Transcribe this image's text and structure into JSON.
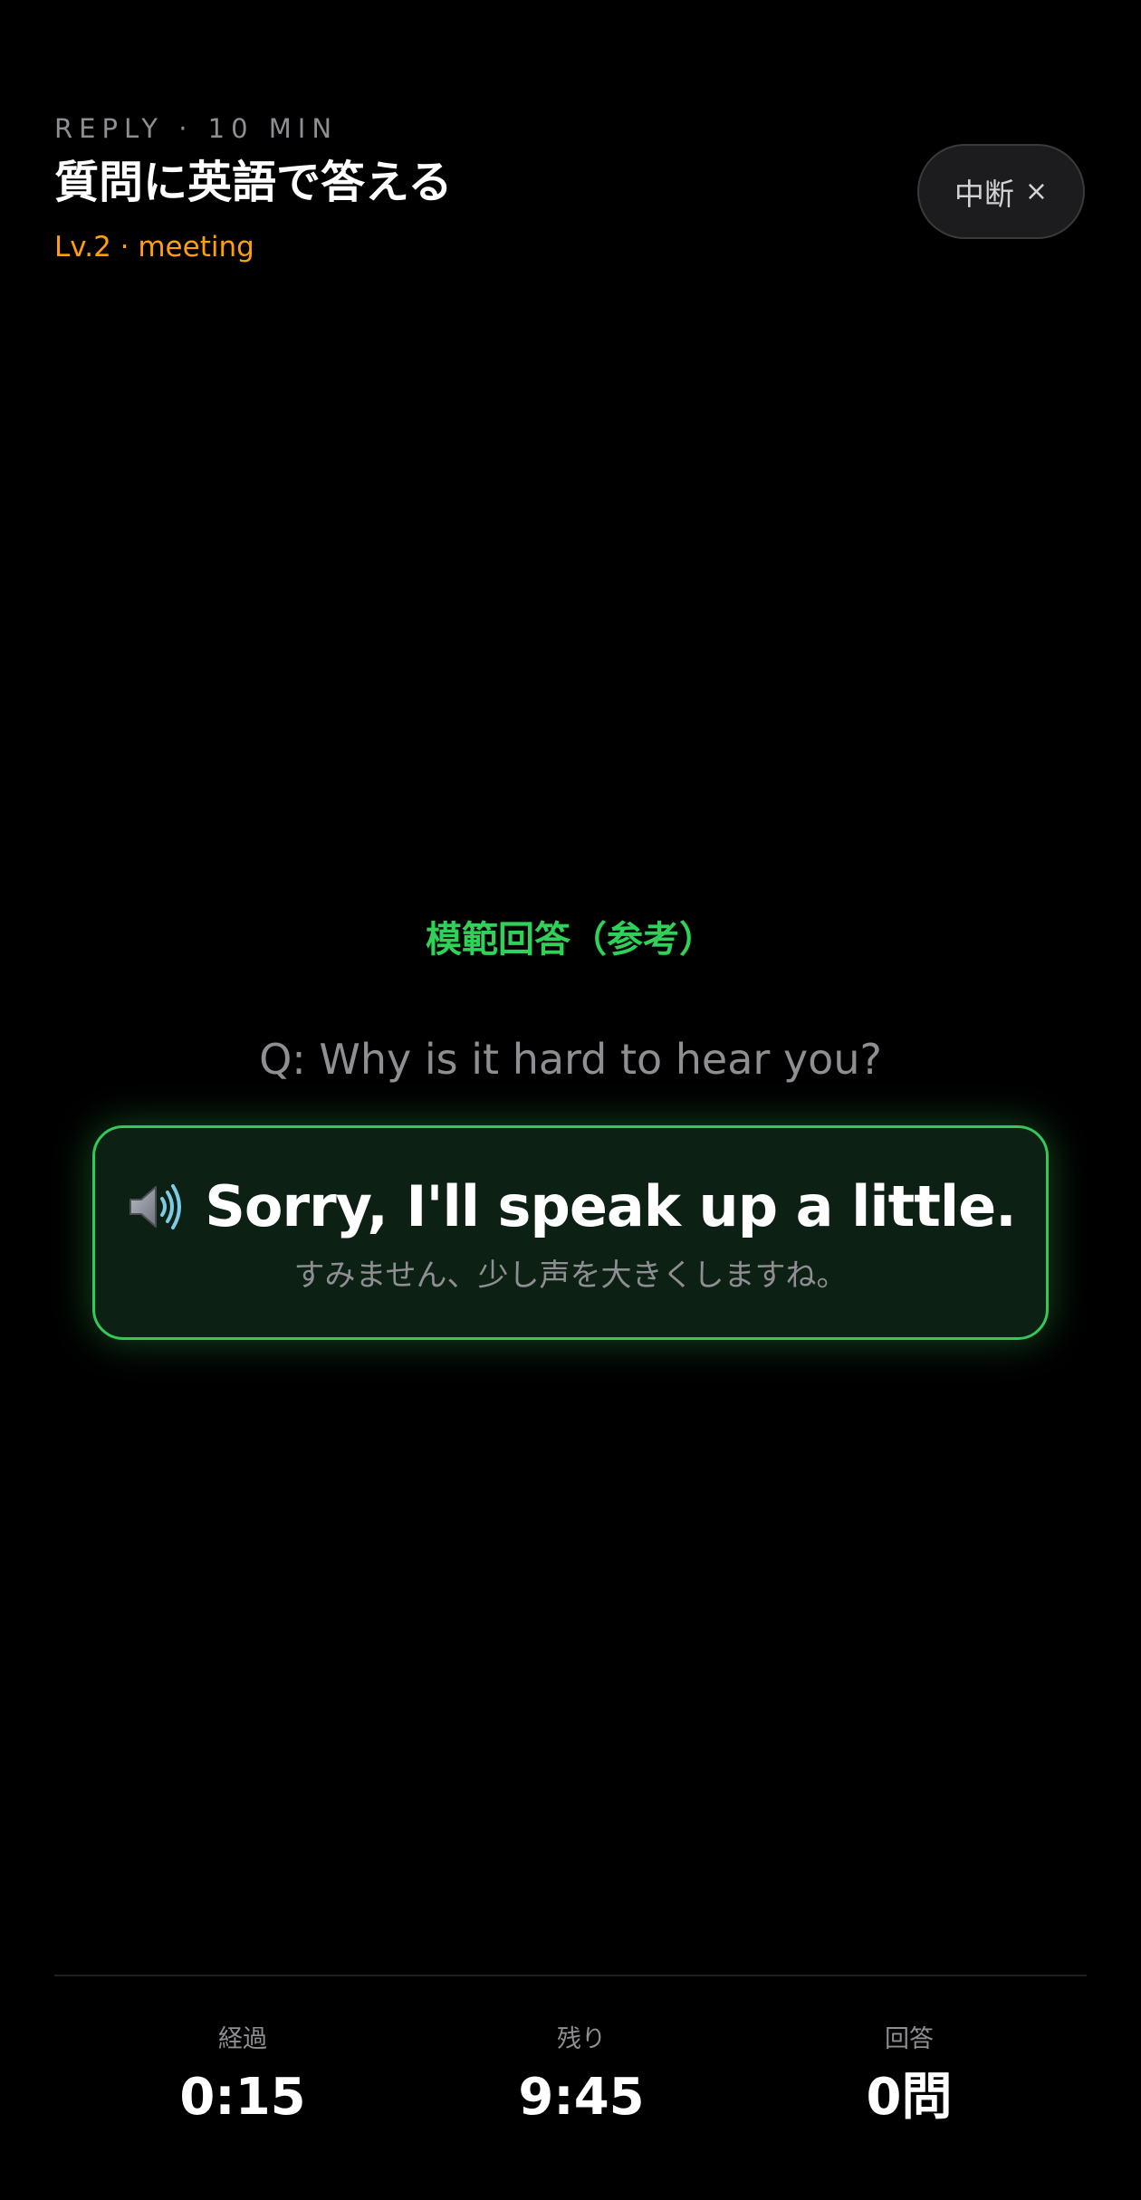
{
  "header": {
    "eyebrow": "REPLY · 10 MIN",
    "title": "質問に英語で答える",
    "subtitle": "Lv.2 · meeting"
  },
  "stop_button": {
    "label": "中断",
    "icon": "close-icon",
    "glyph": "×"
  },
  "main": {
    "model_label": "模範回答（参考）",
    "question": "Q: Why is it hard to hear you?",
    "answer": {
      "icon": "speaker-icon",
      "text": "Sorry, I'll speak up a little.",
      "translation": "すみません、少し声を大きくしますね。"
    }
  },
  "stats": [
    {
      "label": "経過",
      "value": "0:15"
    },
    {
      "label": "残り",
      "value": "9:45"
    },
    {
      "label": "回答",
      "value": "0問"
    }
  ],
  "colors": {
    "background": "#000000",
    "accent_green": "#34c759",
    "accent_orange": "#ff9f0a",
    "muted_text": "#8e8e93"
  }
}
